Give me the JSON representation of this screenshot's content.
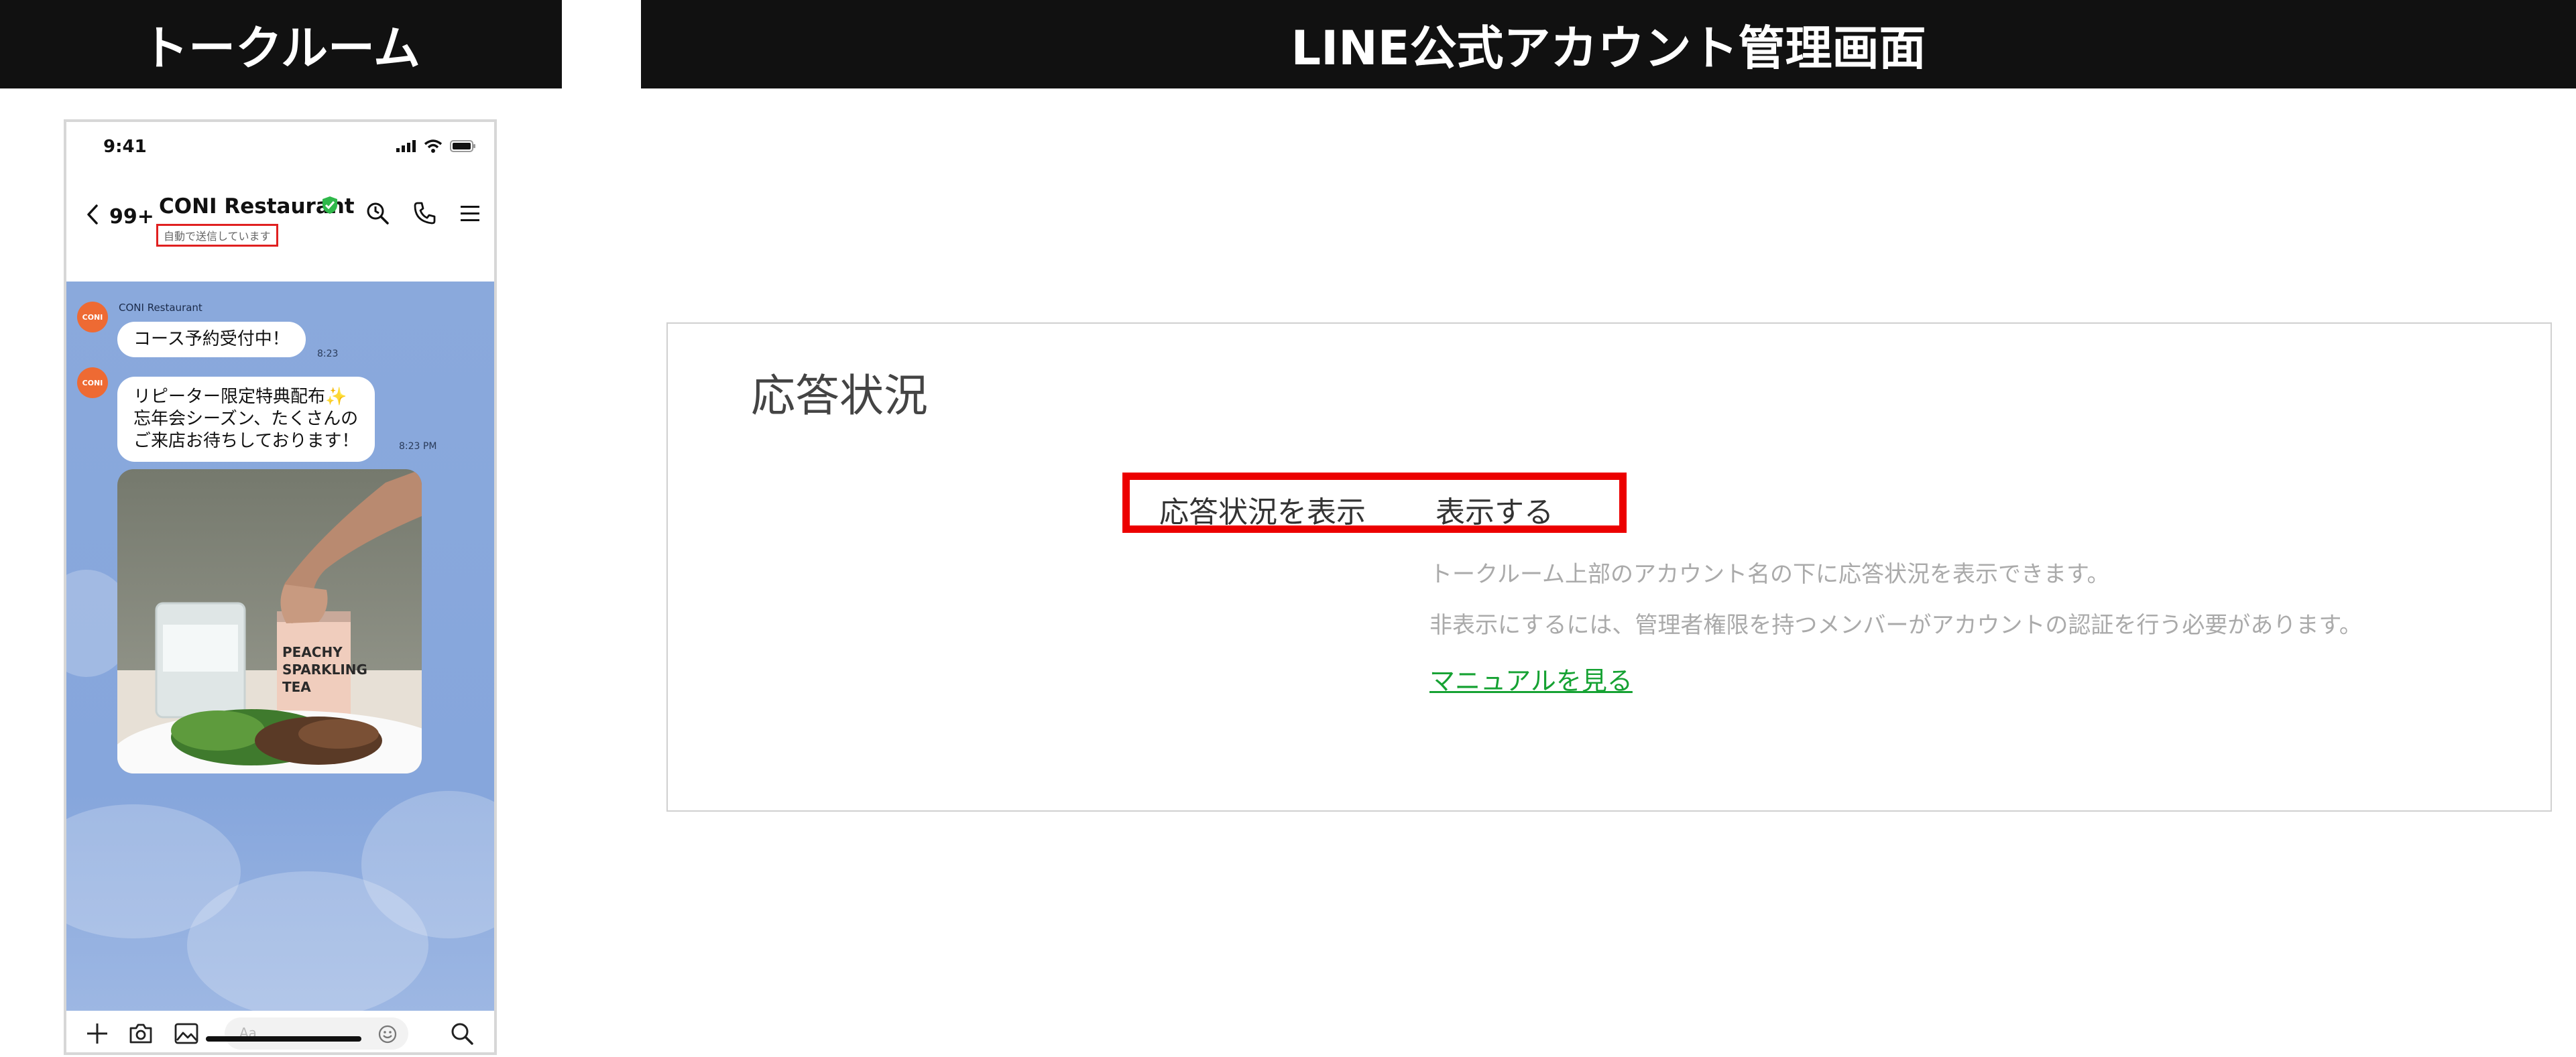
{
  "headers": {
    "left": "トークルーム",
    "right": "LINE公式アカウント管理画面"
  },
  "phone": {
    "time": "9:41",
    "nav": {
      "unread_count": "99+",
      "account_name": "CONI Restaurant",
      "auto_reply_status": "自動で送信しています"
    },
    "chat": {
      "sender_name": "CONI Restaurant",
      "avatar_label": "CONI",
      "messages": [
        {
          "text": "コース予約受付中！",
          "time": "8:23"
        },
        {
          "line1": "リピーター限定特典配布✨",
          "line2": "忘年会シーズン、たくさんの",
          "line3": "ご来店お待ちしております！",
          "time": "8:23 PM"
        }
      ],
      "photo_can_text": {
        "line1": "PEACHY",
        "line2": "SPARKLING",
        "line3": "TEA"
      }
    },
    "input_placeholder": "Aa"
  },
  "admin": {
    "title": "応答状況",
    "setting_label": "応答状況を表示",
    "setting_value": "表示する",
    "desc1": "トークルーム上部のアカウント名の下に応答状況を表示できます。",
    "desc2": "非表示にするには、管理者権限を持つメンバーがアカウントの認証を行う必要があります。",
    "manual_link": "マニュアルを見る"
  },
  "colors": {
    "highlight": "#ec0000",
    "link": "#16a233",
    "chat_bg": "#86a6dc",
    "avatar": "#ee6a33",
    "verified": "#2fb84a"
  },
  "icons": [
    "back-chevron-icon",
    "verified-badge-icon",
    "search-icon",
    "phone-icon",
    "menu-icon",
    "plus-icon",
    "camera-icon",
    "image-icon",
    "emoji-icon",
    "search-icon"
  ]
}
